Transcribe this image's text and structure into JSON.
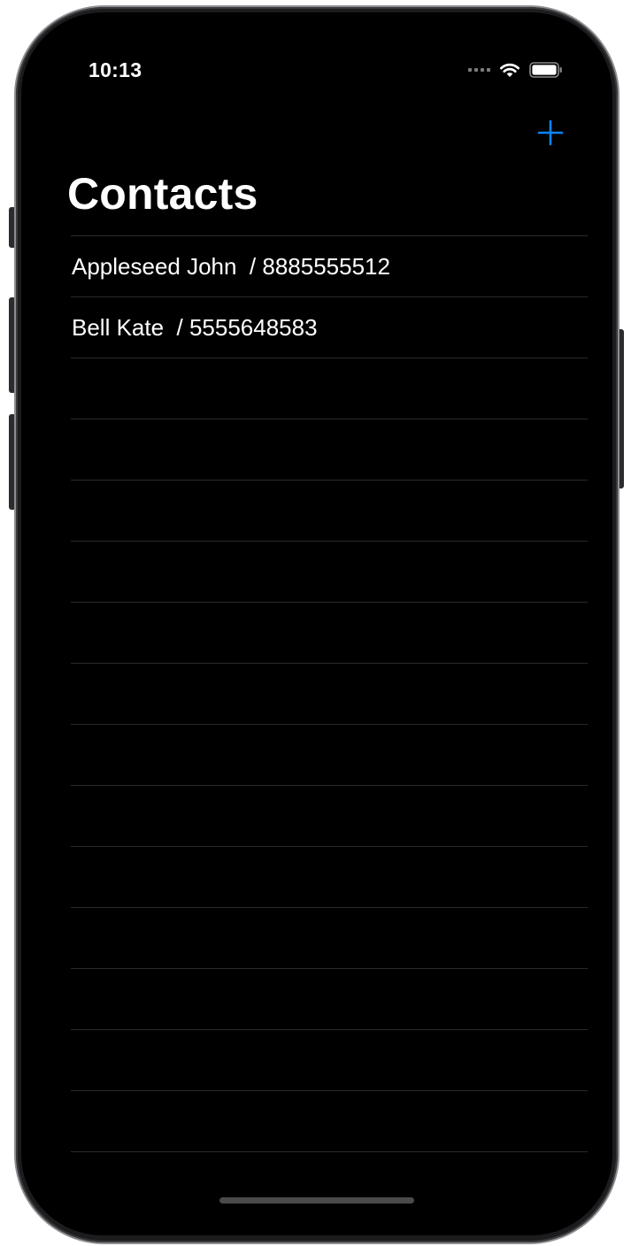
{
  "status_bar": {
    "time": "10:13",
    "signal_icon": "signal-icon",
    "wifi_icon": "wifi-icon",
    "battery_icon": "battery-icon"
  },
  "nav": {
    "add_icon": "plus-icon",
    "title": "Contacts"
  },
  "contacts": [
    {
      "label": "Appleseed John  / 8885555512"
    },
    {
      "label": "Bell Kate  / 5555648583"
    }
  ],
  "empty_rows": 14,
  "colors": {
    "accent": "#0a84ff",
    "background": "#000000",
    "text": "#ffffff",
    "separator": "#2a2a2c"
  }
}
